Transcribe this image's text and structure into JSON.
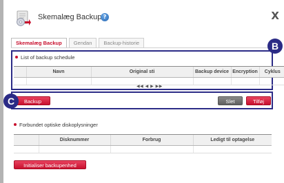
{
  "window": {
    "title": "Skemalæg Backup",
    "help_icon": "?",
    "close_icon": "X"
  },
  "tabs": [
    {
      "label": "Skemalæg Backup",
      "active": true
    },
    {
      "label": "Gendan",
      "active": false
    },
    {
      "label": "Backup-historie",
      "active": false
    }
  ],
  "schedule": {
    "section_label": "List of backup schedule",
    "columns": [
      "",
      "Navn",
      "Original sti",
      "Backup device",
      "Encryption",
      "Cyklus"
    ],
    "pager": "◀◀ ◀ ▶ ▶▶"
  },
  "actions": {
    "backup_label": "Backup",
    "delete_label": "Slet",
    "add_label": "Tilføj"
  },
  "disks": {
    "section_label": "Forbundet optiske diskoplysninger",
    "columns": [
      "",
      "Disknummer",
      "Forbrug",
      "Ledigt til optagelse"
    ],
    "init_label": "Initialiser backupenhed"
  },
  "callouts": {
    "b": "B",
    "c": "C"
  },
  "colors": {
    "accent_red": "#c8102e",
    "callout_navy": "#2b2b86",
    "gray_button": "#6f6f6f"
  }
}
